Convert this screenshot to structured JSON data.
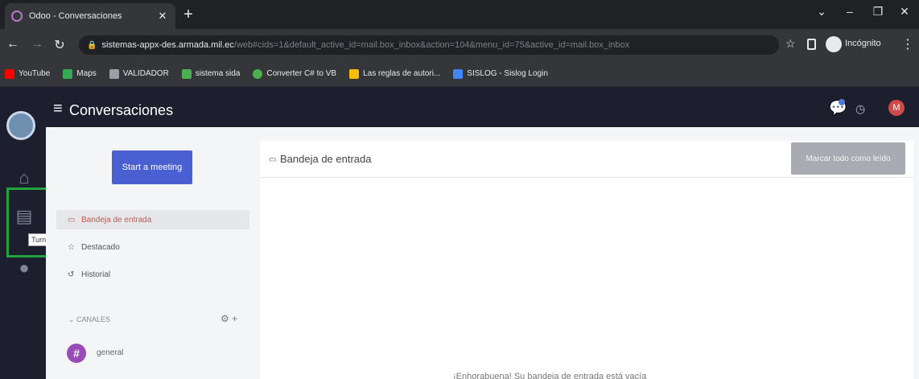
{
  "browser": {
    "tab_title": "Odoo - Conversaciones",
    "url_host": "sistemas-appx-des.armada.mil.ec",
    "url_path": "/web#cids=1&default_active_id=mail.box_inbox&action=104&menu_id=75&active_id=mail.box_inbox",
    "incognito_label": "Incógnito",
    "bookmarks": [
      {
        "label": "YouTube",
        "color": "#ff0000"
      },
      {
        "label": "Maps",
        "color": "#34a853"
      },
      {
        "label": "VALIDADOR",
        "color": "#5f6368"
      },
      {
        "label": "sistema sida",
        "color": "#4caf50"
      },
      {
        "label": "Converter C# to VB",
        "color": "#4caf50"
      },
      {
        "label": "Las reglas de autori...",
        "color": "#fbbc04"
      },
      {
        "label": "SISLOG - Sislog Login",
        "color": "#4285f4"
      }
    ]
  },
  "app": {
    "title": "Conversaciones",
    "avatar_letter": "M",
    "tooltip": "Turnos",
    "start_meeting_label": "Start a meeting",
    "sidebar_items": [
      "Bandeja de entrada",
      "Destacado",
      "Historial"
    ],
    "channels_header": "CANALES",
    "channel_name": "general",
    "inbox_title": "Bandeja de entrada",
    "mark_all_read_label": "Marcar todo como leído",
    "empty_message": "¡Enhorabuena! Su bandeja de entrada está vacía"
  },
  "colors": {
    "highlight_box": "#21a33f",
    "meeting_button": "#4a5fd2",
    "active_item_text": "#c05a52",
    "channel_avatar": "#9a4bb5"
  }
}
